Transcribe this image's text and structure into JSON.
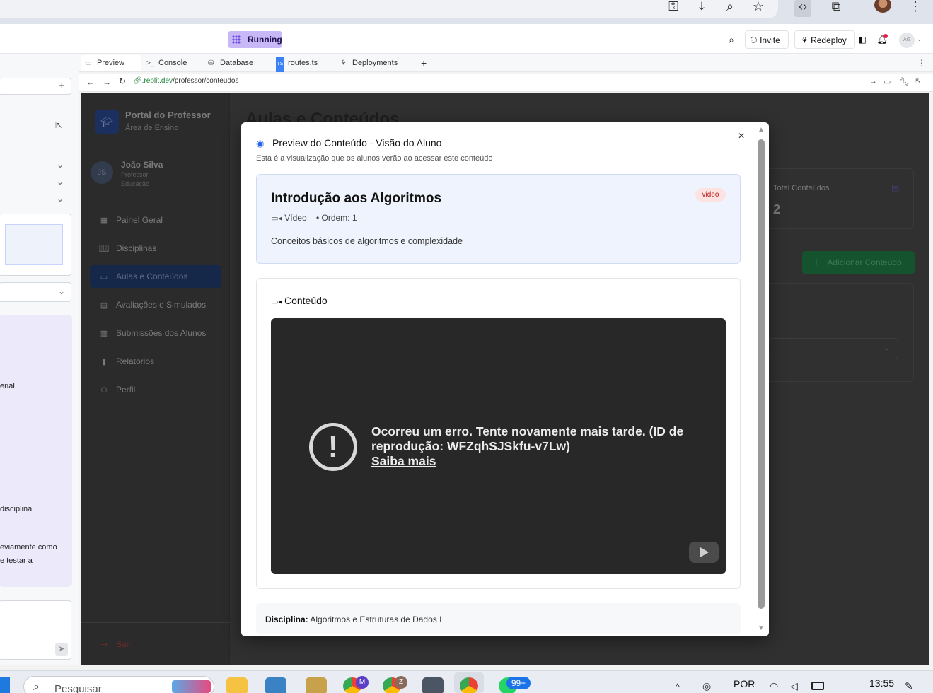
{
  "replit": {
    "status": "Running",
    "invite": "Invite",
    "redeploy": "Redeploy",
    "avatar_initials": "AG"
  },
  "tabs": [
    {
      "label": "Preview",
      "icon": "monitor-icon"
    },
    {
      "label": "Console",
      "icon": "terminal-icon"
    },
    {
      "label": "Database",
      "icon": "database-icon"
    },
    {
      "label": "routes.ts",
      "icon": "typescript-file-icon"
    },
    {
      "label": "Deployments",
      "icon": "deploy-icon"
    }
  ],
  "url": {
    "domain": ".replit.dev",
    "path": "/professor/conteudos"
  },
  "left_pane": {
    "snippets": [
      "erial",
      "disciplina",
      "eviamente como",
      "e testar a"
    ]
  },
  "app": {
    "brand_title": "Portal do Professor",
    "brand_subtitle": "Área de Ensino",
    "user_initials": "JS",
    "user_name": "João Silva",
    "user_role": "Professor",
    "user_area": "Educação",
    "nav": [
      "Painel Geral",
      "Disciplinas",
      "Aulas e Conteúdos",
      "Avaliações e Simulados",
      "Submissões dos Alunos",
      "Relatórios",
      "Perfil"
    ],
    "logout": "Sair",
    "page_title": "Aulas e Conteúdos",
    "stat_label": "Total Conteúdos",
    "stat_value": "2",
    "add_button": "Adicionar Conteúdo"
  },
  "modal": {
    "title": "Preview do Conteúdo - Visão do Aluno",
    "subtitle": "Esta é a visualização que os alunos verão ao acessar este conteúdo",
    "lesson_title": "Introdução aos Algoritmos",
    "badge": "video",
    "type_label": "Vídeo",
    "order_label": "• Ordem: 1",
    "description": "Conceitos básicos de algoritmos e complexidade",
    "content_heading": "Conteúdo",
    "error_text": "Ocorreu um erro. Tente novamente mais tarde. (ID de reprodução: WFZqhSJSkfu-v7Lw)",
    "error_link": "Saiba mais",
    "discipline_label": "Disciplina:",
    "discipline_value": "Algoritmos e Estruturas de Dados I"
  },
  "taskbar": {
    "search_placeholder": "Pesquisar",
    "notification_badge": "99+",
    "language": "POR",
    "time": "13:55"
  },
  "colors": {
    "running_bg": "#c9b8f7",
    "active_nav": "#16284a",
    "info_card_bg": "#eef3fd",
    "badge_bg": "#fde2e2",
    "add_button_bg": "#14532d",
    "video_bg": "#282828"
  }
}
